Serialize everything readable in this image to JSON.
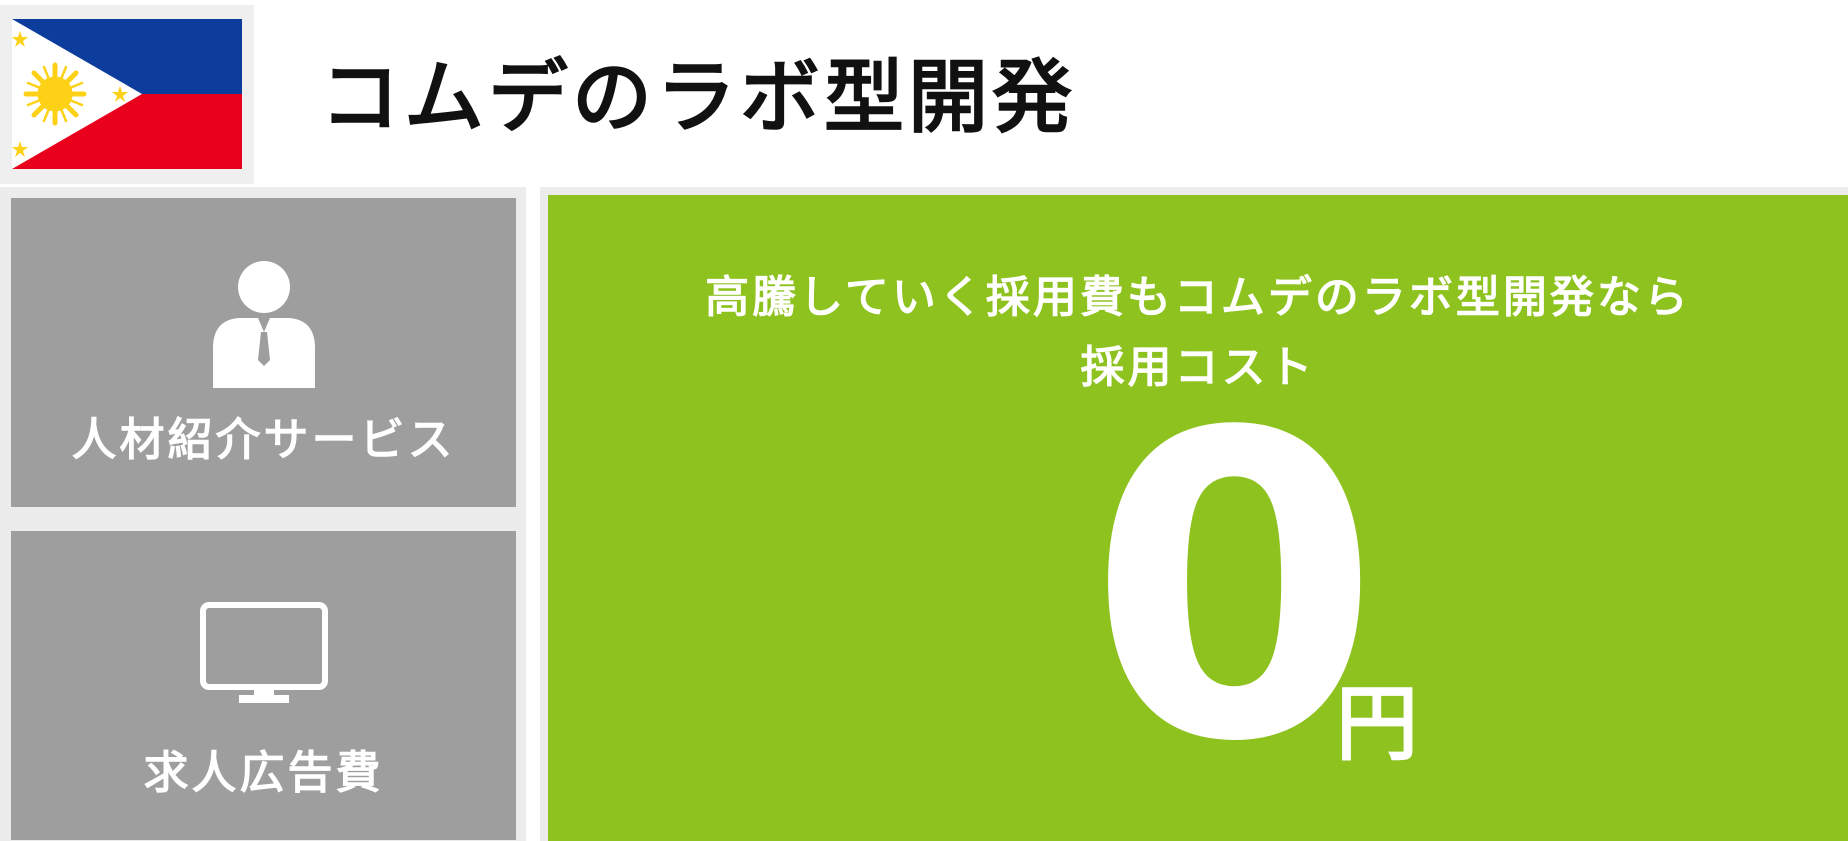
{
  "header": {
    "title": "コムデのラボ型開発",
    "flag_icon": "philippines-flag-icon"
  },
  "cards": [
    {
      "label": "人材紹介サービス",
      "icon": "businessman-icon"
    },
    {
      "label": "求人広告費",
      "icon": "monitor-icon"
    }
  ],
  "promo": {
    "line1": "高騰していく採用費もコムデのラボ型開発なら",
    "line2": "採用コスト",
    "amount": "0",
    "unit": "円"
  },
  "colors": {
    "accent_green": "#8dc21f",
    "card_gray": "#9e9e9e",
    "flag_blue": "#0c3d9c",
    "flag_red": "#e8001c",
    "flag_yellow": "#fcd116"
  }
}
